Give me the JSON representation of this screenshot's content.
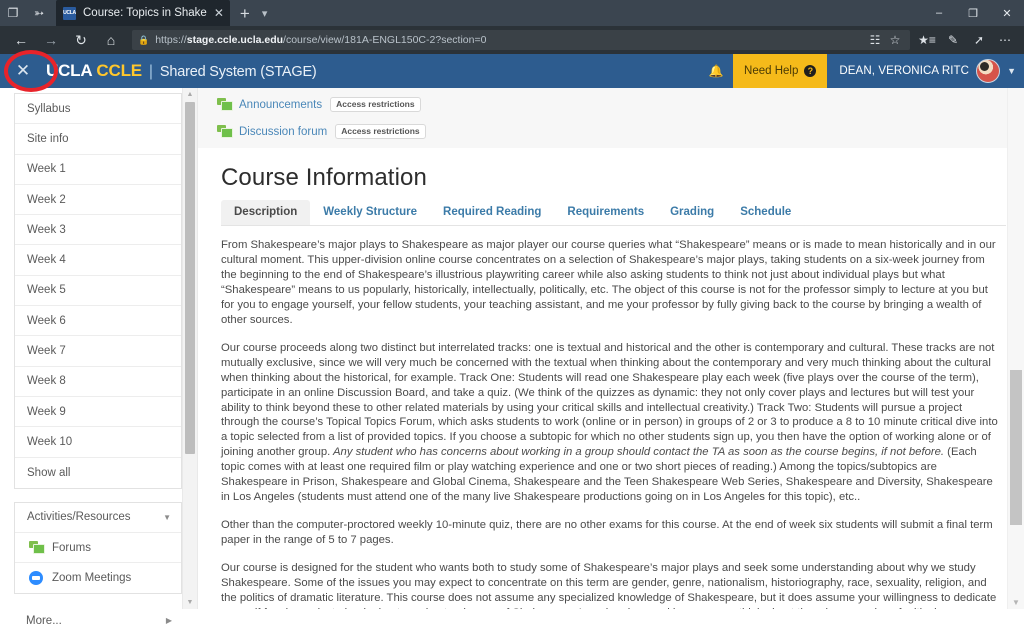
{
  "browser": {
    "tab": {
      "title": "Course: Topics in Shake",
      "favicon_label": "UCLA",
      "close_icon": "close-icon"
    },
    "new_tab_label": "+",
    "tab_list_icon": "chevron-down-icon",
    "left_icons": [
      "task-view-icon",
      "set-tabs-aside-icon"
    ],
    "window_controls": {
      "minimize": "–",
      "maximize": "❐",
      "close": "✕"
    },
    "toolbar": {
      "back_icon": "back-arrow-icon",
      "forward_icon": "forward-arrow-icon",
      "refresh_icon": "refresh-icon",
      "home_icon": "home-icon",
      "lock_icon": "lock-icon",
      "url_prefix": "https://",
      "url_domain": "stage.ccle.ucla.edu",
      "url_path": "/course/view/181A-ENGL150C-2?section=0",
      "reading_view_icon": "reading-view-icon",
      "favorite_icon": "star-icon",
      "favorites_hub_icon": "favorites-hub-icon",
      "notes_icon": "web-notes-icon",
      "share_icon": "share-icon",
      "settings_icon": "more-ellipsis-icon"
    }
  },
  "site_header": {
    "menu_toggle_icon": "close-x-icon",
    "brand_ucla": "UCLA",
    "brand_ccle": "CCLE",
    "brand_separator": "|",
    "brand_system": "Shared System (STAGE)",
    "bell_icon": "notification-bell-icon",
    "need_help_label": "Need Help",
    "need_help_badge": "?",
    "user_name": "DEAN, VERONICA RITC",
    "avatar_icon": "user-avatar",
    "caret_icon": "chevron-down-icon",
    "accent_blue": "#2d5c8f",
    "accent_gold": "#f5ba1a"
  },
  "sidebar": {
    "sections": [
      {
        "name": "course-sections",
        "items": [
          {
            "label": "Syllabus"
          },
          {
            "label": "Site info"
          },
          {
            "label": "Week 1"
          },
          {
            "label": "Week 2"
          },
          {
            "label": "Week 3"
          },
          {
            "label": "Week 4"
          },
          {
            "label": "Week 5"
          },
          {
            "label": "Week 6"
          },
          {
            "label": "Week 7"
          },
          {
            "label": "Week 8"
          },
          {
            "label": "Week 9"
          },
          {
            "label": "Week 10"
          },
          {
            "label": "Show all"
          }
        ]
      }
    ],
    "activities": {
      "header": "Activities/Resources",
      "collapse_icon": "chevron-down-icon",
      "items": [
        {
          "label": "Forums",
          "icon": "forum-icon"
        },
        {
          "label": "Zoom Meetings",
          "icon": "zoom-icon"
        }
      ],
      "more_label": "More...",
      "more_icon": "chevron-right-icon"
    },
    "scrollbar": {
      "up_icon": "scroll-up-icon",
      "down_icon": "scroll-down-icon"
    }
  },
  "main": {
    "links": [
      {
        "label": "Announcements",
        "icon": "forum-icon",
        "badge": "Access restrictions"
      },
      {
        "label": "Discussion forum",
        "icon": "forum-icon",
        "badge": "Access restrictions"
      }
    ],
    "title": "Course Information",
    "tabs": [
      {
        "label": "Description",
        "active": true
      },
      {
        "label": "Weekly Structure",
        "active": false
      },
      {
        "label": "Required Reading",
        "active": false
      },
      {
        "label": "Requirements",
        "active": false
      },
      {
        "label": "Grading",
        "active": false
      },
      {
        "label": "Schedule",
        "active": false
      }
    ],
    "paragraphs": [
      "From Shakespeare’s major plays to Shakespeare as major player our course queries what “Shakespeare” means or is made to mean historically and in our cultural moment.  This upper-division online course concentrates on a selection of Shakespeare’s major plays, taking students on a six-week journey from the beginning to the end of Shakespeare’s illustrious playwriting career while also asking students to think not just about individual plays but what “Shakespeare” means to us popularly, historically, intellectually, politically, etc.  The object of this course is not for the professor simply to lecture at you but for you to engage yourself, your fellow students, your teaching assistant, and me your professor by fully giving back to the course by bringing a wealth of other sources.",
      "Our course proceeds along two distinct but interrelated tracks:  one is textual and historical and the other is contemporary and cultural.  These tracks are not mutually exclusive, since we will very much be concerned with the textual when thinking about the contemporary and very much thinking about the cultural when thinking about the historical, for example.  Track One: Students will read one Shakespeare play each week (five plays over the course of the term), participate in an online Discussion Board, and take a quiz. (We think of the quizzes as dynamic: they not only cover plays and lectures but will test your ability to think beyond these to other related materials by using your critical skills and intellectual creativity.)  Track Two: Students will pursue a project through the course’s Topical Topics Forum, which asks students to work (online or in person) in groups of 2 or 3 to produce a 8 to 10 minute critical dive into a topic selected from a list of provided topics. If you choose a subtopic for which no other students sign up, you then have the option of working alone or of joining another group.",
      "Other than the computer-proctored weekly 10-minute quiz, there are no other exams for this course.  At the end of week six students will submit a final term paper in the range of 5 to 7 pages.",
      "Our course is designed for the student who wants both to study some of Shakespeare’s major plays and seek some understanding about why we study Shakespeare.  Some of the issues you may expect to concentrate on this term are gender, genre, nationalism, historiography, race, sexuality, religion, and the politics of dramatic literature.  This course does not assume any specialized knowledge of Shakespeare, but it does assume your willingness to dedicate yourself for six weeks to beginning to understand some of Shakespeare’s major plays and how we may think about them in a complex of critical conversations taking place in literary and cultural studies."
    ],
    "paragraph2_italic": "Any student who has concerns about working in a group should contact the TA as soon as the course begins, if not before.",
    "paragraph2_tail": "(Each topic comes with at least one required film or play watching experience and one or two short pieces of reading.)  Among the topics/subtopics are Shakespeare in Prison, Shakespeare and Global Cinema, Shakespeare and the Teen Shakespeare Web Series, Shakespeare and Diversity, Shakespeare in Los Angeles (students must attend one of the many live Shakespeare productions going on in Los Angeles for this topic), etc..",
    "scrollbar": {
      "down_icon": "scroll-down-icon"
    }
  },
  "annotation": {
    "shape": "red-circle-highlight",
    "color": "#e8232a",
    "target": "menu-toggle"
  }
}
